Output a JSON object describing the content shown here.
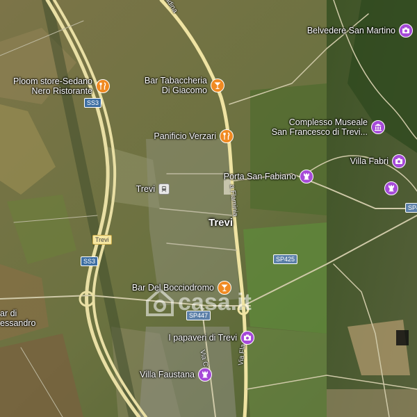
{
  "map": {
    "city_label": "Trevi",
    "road_labels": {
      "flaminia_top": "adina",
      "flaminia_mid": "a Flaminia",
      "flaminia_bottom": "Via Fla",
      "via_c": "Via C"
    },
    "shields": {
      "ss3_top": "SS3",
      "ss3_bottom": "SS3",
      "trevi_shield": "Trevi",
      "sp425": "SP425",
      "sp447": "SP447",
      "sp_right_edge": "SP4"
    },
    "partial_label": {
      "line1": "ar di",
      "line2": "essandro"
    },
    "watermark": "casa.it",
    "pois": [
      {
        "key": "belvedere",
        "label": "Belvedere San Martino",
        "type": "attraction",
        "icon": "camera-icon"
      },
      {
        "key": "ploom",
        "label": "Ploom store-Sedano\nNero Ristorante",
        "type": "restaurant",
        "icon": "restaurant-icon"
      },
      {
        "key": "tabaccheria",
        "label": "Bar Tabaccheria\nDi Giacomo",
        "type": "restaurant",
        "icon": "cocktail-icon"
      },
      {
        "key": "complesso",
        "label": "Complesso Museale\nSan Francesco di Trevi...",
        "type": "attraction",
        "icon": "museum-icon"
      },
      {
        "key": "panificio",
        "label": "Panificio Verzari",
        "type": "restaurant",
        "icon": "restaurant-icon"
      },
      {
        "key": "villa_fabri",
        "label": "Villa Fabri",
        "type": "attraction",
        "icon": "camera-icon"
      },
      {
        "key": "porta",
        "label": "Porta San Fabiano",
        "type": "attraction",
        "icon": "chess-rook-icon"
      },
      {
        "key": "trevi_station",
        "label": "Trevi",
        "type": "transit",
        "icon": "train-icon"
      },
      {
        "key": "bocciodromo",
        "label": "Bar Del Bocciodromo",
        "type": "restaurant",
        "icon": "cocktail-icon"
      },
      {
        "key": "papaveri",
        "label": "I papaveri di Trevi",
        "type": "attraction",
        "icon": "camera-icon"
      },
      {
        "key": "villa_faustana",
        "label": "Villa Faustana",
        "type": "attraction",
        "icon": "chess-rook-icon"
      },
      {
        "key": "unlabeled_tower",
        "label": "",
        "type": "attraction",
        "icon": "chess-rook-icon"
      }
    ],
    "colors": {
      "restaurant_pin": "#f08a22",
      "attraction_pin": "#a64ad8",
      "highway": "#e9dfa4",
      "road": "#cfc9a8"
    }
  }
}
